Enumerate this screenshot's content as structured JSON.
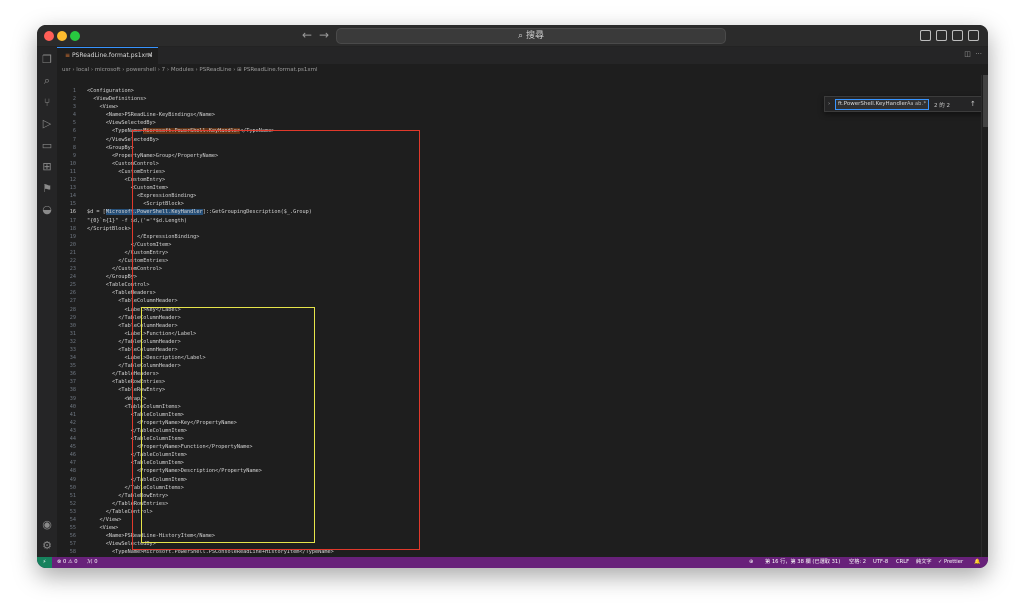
{
  "window": {
    "command_center_text": "搜尋",
    "back_label": "←",
    "forward_label": "→"
  },
  "tab": {
    "label": "PSReadLine.format.ps1xml",
    "close": "×"
  },
  "breadcrumb": "usr › local › microsoft › powershell › 7 › Modules › PSReadLine › ⊞ PSReadLine.format.ps1xml",
  "find": {
    "query": "ft.PowerShell.KeyHandler",
    "match_case": "Aa",
    "whole_word": "ab",
    "regex": ".*",
    "count": "2 的 2",
    "prev": "↑",
    "next": "↓",
    "in_selection": "≡",
    "close": "×"
  },
  "current_line": 16,
  "code_lines": [
    {
      "n": "1",
      "text": "<Configuration>"
    },
    {
      "n": "2",
      "text": "  <ViewDefinitions>"
    },
    {
      "n": "3",
      "text": "    <View>"
    },
    {
      "n": "4",
      "text": "      <Name>PSReadLine-KeyBindings</Name>"
    },
    {
      "n": "5",
      "text": "      <ViewSelectedBy>"
    },
    {
      "n": "6",
      "text": "        <TypeName>Microsoft.PowerShell.KeyHandler</TypeName>"
    },
    {
      "n": "7",
      "text": "      </ViewSelectedBy>"
    },
    {
      "n": "8",
      "text": "      <GroupBy>"
    },
    {
      "n": "9",
      "text": "        <PropertyName>Group</PropertyName>"
    },
    {
      "n": "10",
      "text": "        <CustomControl>"
    },
    {
      "n": "11",
      "text": "          <CustomEntries>"
    },
    {
      "n": "12",
      "text": "            <CustomEntry>"
    },
    {
      "n": "13",
      "text": "              <CustomItem>"
    },
    {
      "n": "14",
      "text": "                <ExpressionBinding>"
    },
    {
      "n": "15",
      "text": "                  <ScriptBlock>"
    },
    {
      "n": "16",
      "text": "$d = [Microsoft.PowerShell.KeyHandler]::GetGroupingDescription($_.Group)"
    },
    {
      "n": "17",
      "text": "\"{0}`n{1}\" -f $d,('='*$d.Length)"
    },
    {
      "n": "18",
      "text": "</ScriptBlock>"
    },
    {
      "n": "19",
      "text": "                </ExpressionBinding>"
    },
    {
      "n": "20",
      "text": "              </CustomItem>"
    },
    {
      "n": "21",
      "text": "            </CustomEntry>"
    },
    {
      "n": "22",
      "text": "          </CustomEntries>"
    },
    {
      "n": "23",
      "text": "        </CustomControl>"
    },
    {
      "n": "24",
      "text": "      </GroupBy>"
    },
    {
      "n": "25",
      "text": "      <TableControl>"
    },
    {
      "n": "26",
      "text": "        <TableHeaders>"
    },
    {
      "n": "27",
      "text": "          <TableColumnHeader>"
    },
    {
      "n": "28",
      "text": "            <Label>Key</Label>"
    },
    {
      "n": "29",
      "text": "          </TableColumnHeader>"
    },
    {
      "n": "30",
      "text": "          <TableColumnHeader>"
    },
    {
      "n": "31",
      "text": "            <Label>Function</Label>"
    },
    {
      "n": "32",
      "text": "          </TableColumnHeader>"
    },
    {
      "n": "33",
      "text": "          <TableColumnHeader>"
    },
    {
      "n": "34",
      "text": "            <Label>Description</Label>"
    },
    {
      "n": "35",
      "text": "          </TableColumnHeader>"
    },
    {
      "n": "36",
      "text": "        </TableHeaders>"
    },
    {
      "n": "37",
      "text": "        <TableRowEntries>"
    },
    {
      "n": "38",
      "text": "          <TableRowEntry>"
    },
    {
      "n": "39",
      "text": "            <Wrap/>"
    },
    {
      "n": "40",
      "text": "            <TableColumnItems>"
    },
    {
      "n": "41",
      "text": "              <TableColumnItem>"
    },
    {
      "n": "42",
      "text": "                <PropertyName>Key</PropertyName>"
    },
    {
      "n": "43",
      "text": "              </TableColumnItem>"
    },
    {
      "n": "44",
      "text": "              <TableColumnItem>"
    },
    {
      "n": "45",
      "text": "                <PropertyName>Function</PropertyName>"
    },
    {
      "n": "46",
      "text": "              </TableColumnItem>"
    },
    {
      "n": "47",
      "text": "              <TableColumnItem>"
    },
    {
      "n": "48",
      "text": "                <PropertyName>Description</PropertyName>"
    },
    {
      "n": "49",
      "text": "              </TableColumnItem>"
    },
    {
      "n": "50",
      "text": "            </TableColumnItems>"
    },
    {
      "n": "51",
      "text": "          </TableRowEntry>"
    },
    {
      "n": "52",
      "text": "        </TableRowEntries>"
    },
    {
      "n": "53",
      "text": "      </TableControl>"
    },
    {
      "n": "54",
      "text": "    </View>"
    },
    {
      "n": "55",
      "text": "    <View>"
    },
    {
      "n": "56",
      "text": "      <Name>PSReadLine-HistoryItem</Name>"
    },
    {
      "n": "57",
      "text": "      <ViewSelectedBy>"
    },
    {
      "n": "58",
      "text": "        <TypeName>Microsoft.PowerShell.PSConsoleReadLine+HistoryItem</TypeName>"
    }
  ],
  "statusbar": {
    "remote": "⚡",
    "problems": "⊗ 0 ⚠ 0",
    "ports": "ℳ 0",
    "zoom": "⊕",
    "position": "第 16 行，第 38 欄 (已選取 31)",
    "indent": "空格: 2",
    "encoding": "UTF-8",
    "eol": "CRLF",
    "language": "純文字",
    "formatter": "✓ Prettier",
    "bell": "🔔"
  },
  "colors": {
    "statusbar": "#68217a",
    "remote": "#16825d",
    "red_box": "#e0392b",
    "yellow_box": "#e6e44a",
    "accent": "#3794ff"
  }
}
